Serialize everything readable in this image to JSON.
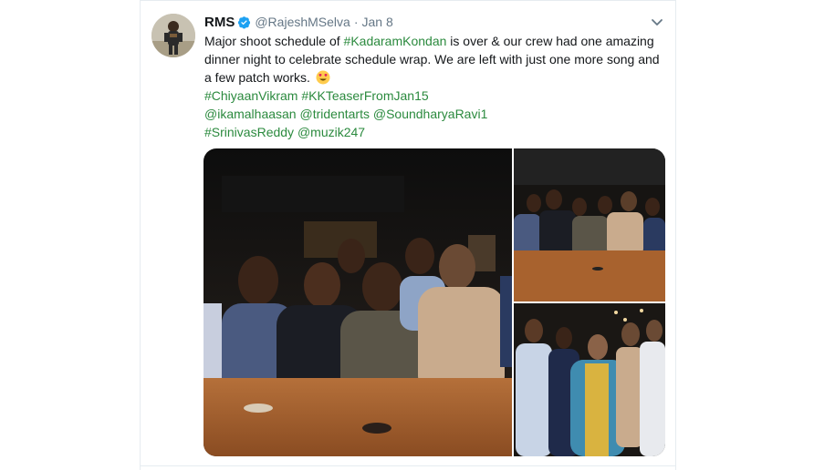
{
  "tweet": {
    "display_name": "RMS",
    "handle": "@RajeshMSelva",
    "separator": "·",
    "date": "Jan 8",
    "text_lines": [
      {
        "before": "Major shoot schedule of ",
        "hashtag": "#KadaramKondan",
        "after": " is over & our crew had one amazing"
      },
      {
        "text": "dinner night to celebrate schedule wrap. We are left with just one more song and"
      },
      {
        "text": "a few patch works."
      }
    ],
    "hashtags_line": [
      "#ChiyaanVikram",
      "#KKTeaserFromJan15"
    ],
    "mentions_line": [
      "@ikamalhaasan",
      "@tridentarts",
      "@SoundharyaRavi1"
    ],
    "last_line": [
      "#SrinivasReddy",
      "@muzik247"
    ],
    "emoji": "smiling-face-with-heart-eyes",
    "icons": {
      "verified": "verified-badge-icon",
      "menu": "chevron-down-icon"
    },
    "colors": {
      "link": "#2b8a3e",
      "text": "#14171a",
      "muted": "#657786",
      "verified": "#1da1f2"
    },
    "media": {
      "count": 3,
      "photos": [
        "group-photo-main",
        "group-photo-top-right",
        "group-photo-bottom-right"
      ]
    }
  }
}
